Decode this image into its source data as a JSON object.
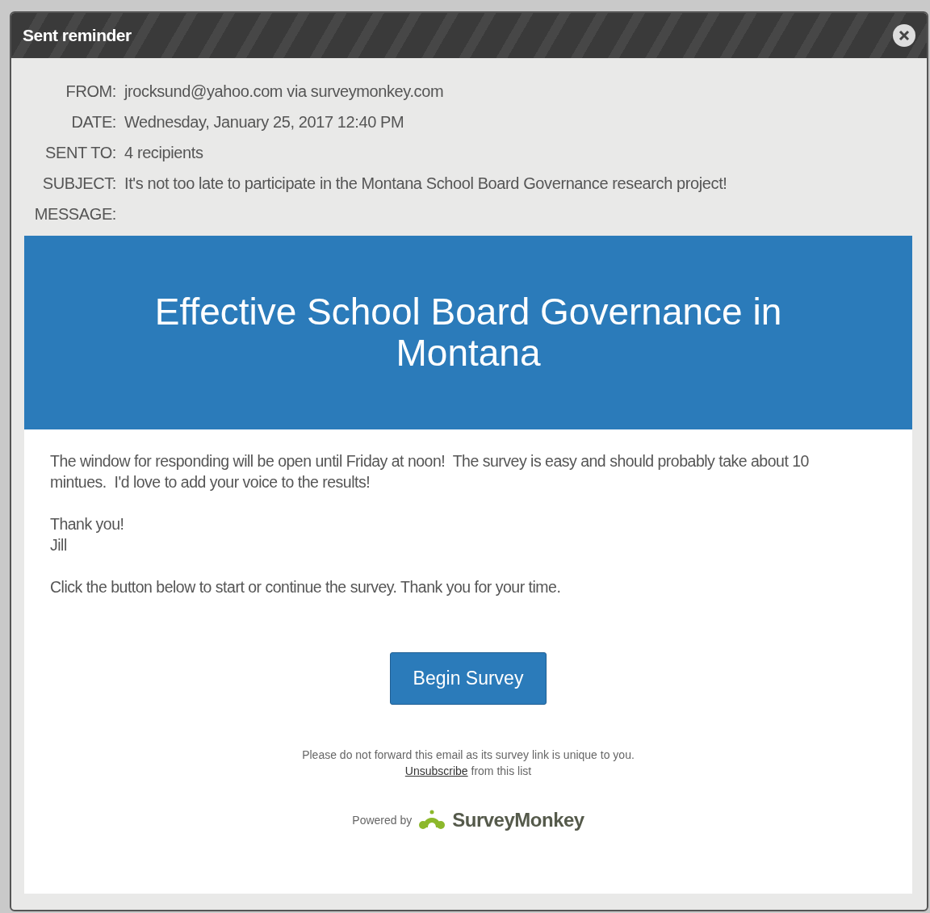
{
  "dialog": {
    "title": "Sent reminder"
  },
  "fields": [
    {
      "label": "FROM:",
      "value": "jrocksund@yahoo.com via surveymonkey.com"
    },
    {
      "label": "DATE:",
      "value": "Wednesday, January 25, 2017 12:40 PM"
    },
    {
      "label": "SENT TO:",
      "value": "4 recipients"
    },
    {
      "label": "SUBJECT:",
      "value": "It's not too late to participate in the Montana School Board Governance research project!"
    },
    {
      "label": "MESSAGE:"
    }
  ],
  "email": {
    "banner_title": "Effective School Board Governance in Montana",
    "paragraphs": [
      [
        "The window for responding will be open until Friday at noon!  The survey is easy and should probably take about 10 mintues.  I'd love to add your voice to the results!"
      ],
      [
        "Thank you!",
        "Jill"
      ],
      [
        "Click the button below to start or continue the survey. Thank you for your time."
      ]
    ],
    "button": "Begin Survey",
    "notice": "Please do not forward this email as its survey link is unique to you.",
    "unsubscribe_link": "Unsubscribe",
    "unsubscribe_rest": "from this list",
    "powered_by": "Powered by",
    "brand": "SurveyMonkey"
  }
}
